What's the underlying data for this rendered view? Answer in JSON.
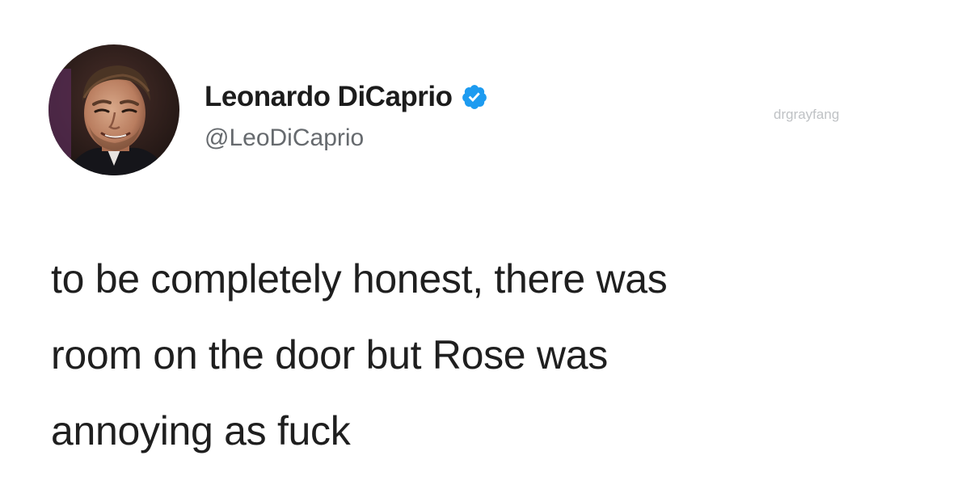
{
  "author": {
    "display_name": "Leonardo DiCaprio",
    "handle": "@LeoDiCaprio",
    "verified": true,
    "avatar_icon": "profile-photo",
    "verified_icon": "verified-check-icon"
  },
  "watermark": "drgrayfang",
  "tweet": {
    "lines": [
      "to be completely honest, there was",
      "room on the door but Rose was",
      "annoying as fuck"
    ]
  },
  "colors": {
    "verified_blue": "#1d9bf0",
    "text": "#1f1f1f",
    "handle": "#666a6e",
    "background": "#ffffff"
  }
}
